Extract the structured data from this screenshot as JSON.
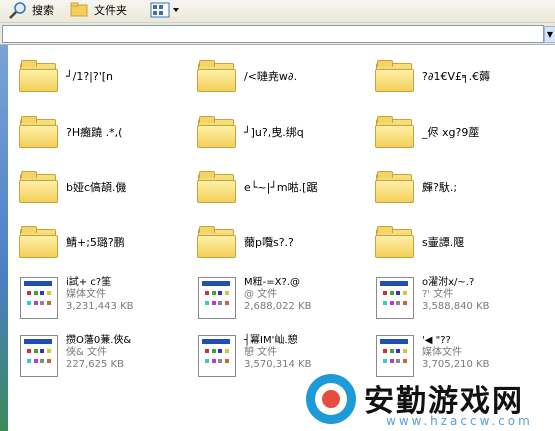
{
  "toolbar": {
    "search_label": "搜索",
    "folders_label": "文件夹"
  },
  "folders": [
    {
      "label": "┘/1?|?'[n"
    },
    {
      "label": "/<嗹尭w∂."
    },
    {
      "label": "?∂1€V£╕.€薅"
    },
    {
      "label": "?H癱蹺 .*,("
    },
    {
      "label": "┘]u?,曳.绑q"
    },
    {
      "label": "_侭 xg?9蓙"
    },
    {
      "label": "b娅c傐頡.僟"
    },
    {
      "label": "e└~|┘m喖.[踞"
    },
    {
      "label": "皹?馱.;"
    },
    {
      "label": "鯖+;5璐?鹏"
    },
    {
      "label": "薾p囕s?.?"
    },
    {
      "label": "s壷譚.隁"
    }
  ],
  "files": [
    {
      "name": "i試+ c?筀",
      "type": "媒体文件",
      "size": "3,231,443 KB"
    },
    {
      "name": "M粈-=X?.@",
      "type": "@ 文件",
      "size": "2,688,022 KB"
    },
    {
      "name": "o濯泭x/~.?",
      "type": "?' 文件",
      "size": "3,588,840 KB"
    },
    {
      "name": "攒O藩0蒹.俠&",
      "type": "俠& 文件",
      "size": "227,625 KB"
    },
    {
      "name": "┤冪IM'屾.憩",
      "type": "憩 文件",
      "size": "3,570,314 KB"
    },
    {
      "name": "'◀ \"??",
      "type": "媒体文件",
      "size": "3,705,210 KB"
    }
  ],
  "watermark": {
    "title": "安勤游戏网",
    "url": "www.hzaccw.com"
  }
}
